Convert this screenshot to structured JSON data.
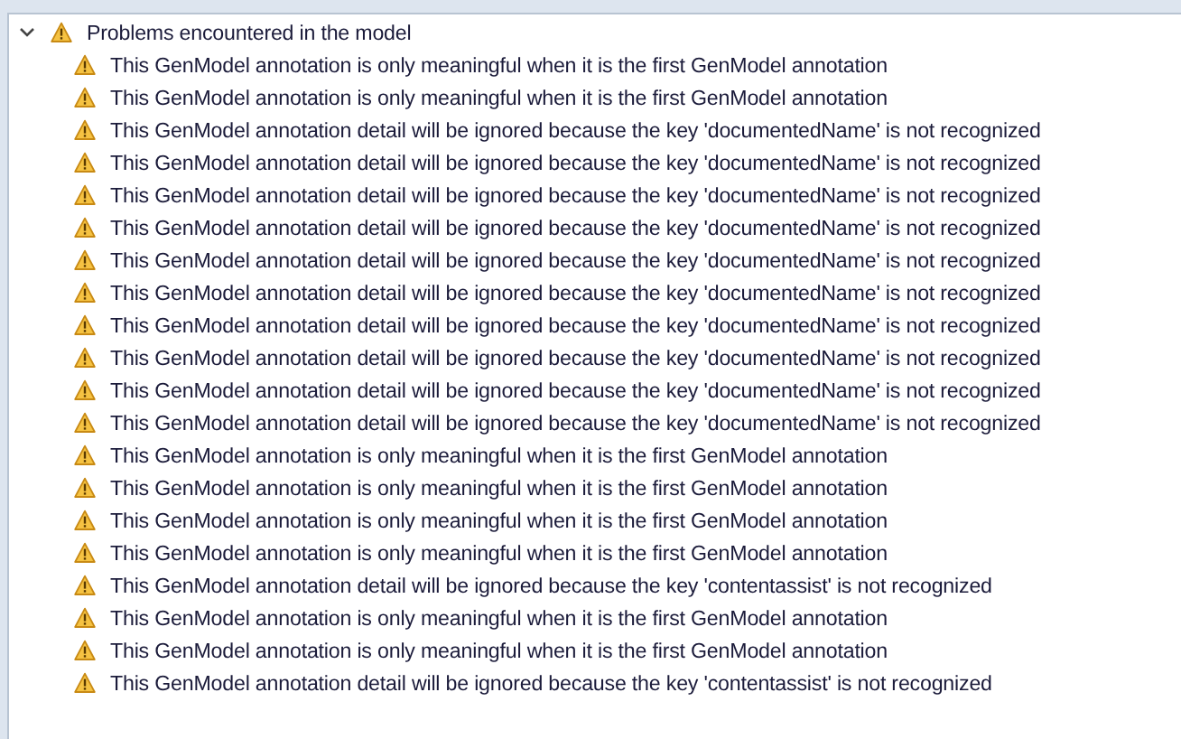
{
  "tree": {
    "label": "Problems encountered in the model",
    "expanded": true,
    "children": [
      {
        "label": "This GenModel annotation is only meaningful when it is the first GenModel annotation"
      },
      {
        "label": "This GenModel annotation is only meaningful when it is the first GenModel annotation"
      },
      {
        "label": "This GenModel annotation detail will be ignored because the key 'documentedName' is not recognized"
      },
      {
        "label": "This GenModel annotation detail will be ignored because the key 'documentedName' is not recognized"
      },
      {
        "label": "This GenModel annotation detail will be ignored because the key 'documentedName' is not recognized"
      },
      {
        "label": "This GenModel annotation detail will be ignored because the key 'documentedName' is not recognized"
      },
      {
        "label": "This GenModel annotation detail will be ignored because the key 'documentedName' is not recognized"
      },
      {
        "label": "This GenModel annotation detail will be ignored because the key 'documentedName' is not recognized"
      },
      {
        "label": "This GenModel annotation detail will be ignored because the key 'documentedName' is not recognized"
      },
      {
        "label": "This GenModel annotation detail will be ignored because the key 'documentedName' is not recognized"
      },
      {
        "label": "This GenModel annotation detail will be ignored because the key 'documentedName' is not recognized"
      },
      {
        "label": "This GenModel annotation detail will be ignored because the key 'documentedName' is not recognized"
      },
      {
        "label": "This GenModel annotation is only meaningful when it is the first GenModel annotation"
      },
      {
        "label": "This GenModel annotation is only meaningful when it is the first GenModel annotation"
      },
      {
        "label": "This GenModel annotation is only meaningful when it is the first GenModel annotation"
      },
      {
        "label": "This GenModel annotation is only meaningful when it is the first GenModel annotation"
      },
      {
        "label": "This GenModel annotation detail will be ignored because the key 'contentassist' is not recognized"
      },
      {
        "label": "This GenModel annotation is only meaningful when it is the first GenModel annotation"
      },
      {
        "label": "This GenModel annotation is only meaningful when it is the first GenModel annotation"
      },
      {
        "label": "This GenModel annotation detail will be ignored because the key 'contentassist' is not recognized"
      }
    ]
  }
}
